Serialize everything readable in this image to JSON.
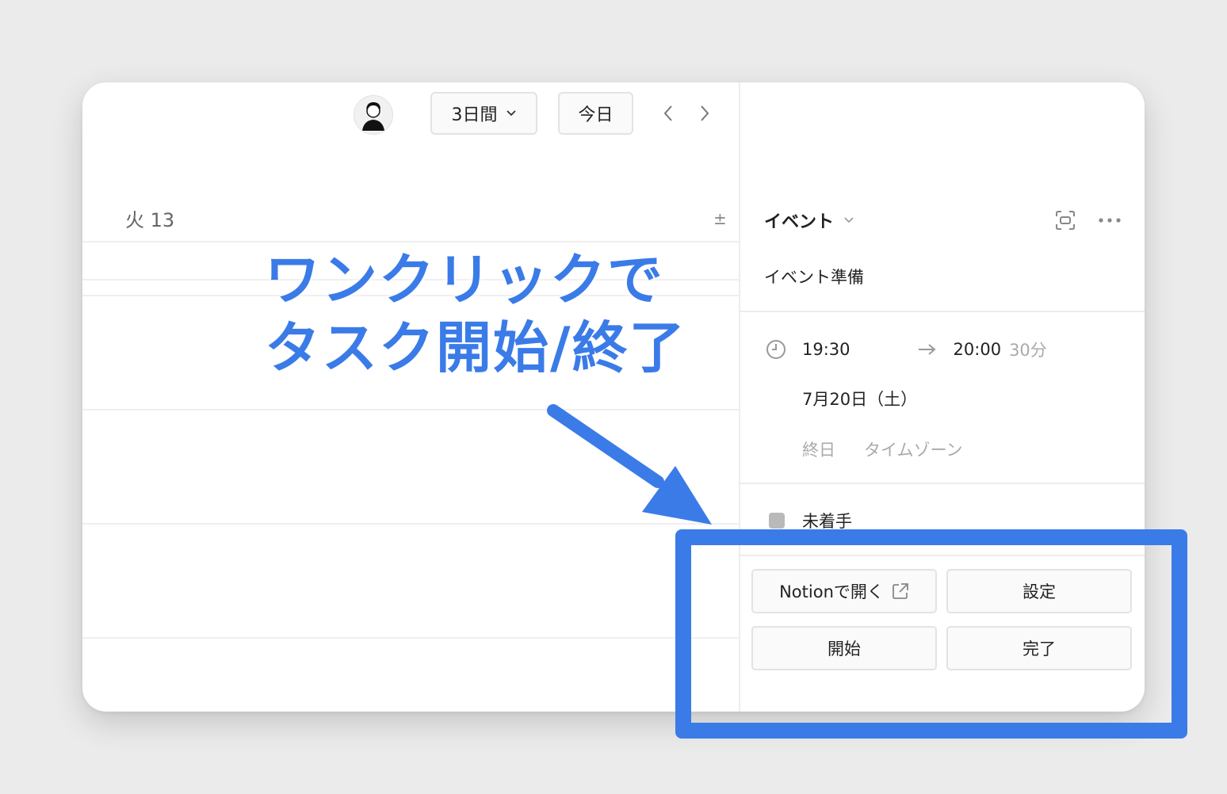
{
  "header": {
    "view_label": "3日間",
    "today_label": "今日"
  },
  "calendar": {
    "day_label": "火 13",
    "plus_minus": "±"
  },
  "panel": {
    "type_label": "イベント",
    "title": "イベント準備",
    "start_time": "19:30",
    "end_time": "20:00",
    "duration": "30分",
    "date": "7月20日（土）",
    "all_day_label": "終日",
    "timezone_label": "タイムゾーン",
    "status_label": "未着手",
    "open_in_notion_label": "Notionで開く",
    "settings_label": "設定",
    "start_label": "開始",
    "complete_label": "完了"
  },
  "annotation": {
    "line1": "ワンクリックで",
    "line2": "タスク開始/終了"
  },
  "colors": {
    "accent": "#3a7be8",
    "status_dot": "#b9b9b9"
  },
  "icons": [
    "avatar",
    "chevron-down-icon",
    "chevron-left-icon",
    "chevron-right-icon",
    "focus-icon",
    "more-icon",
    "clock-icon",
    "arrow-right-icon",
    "external-link-icon"
  ]
}
